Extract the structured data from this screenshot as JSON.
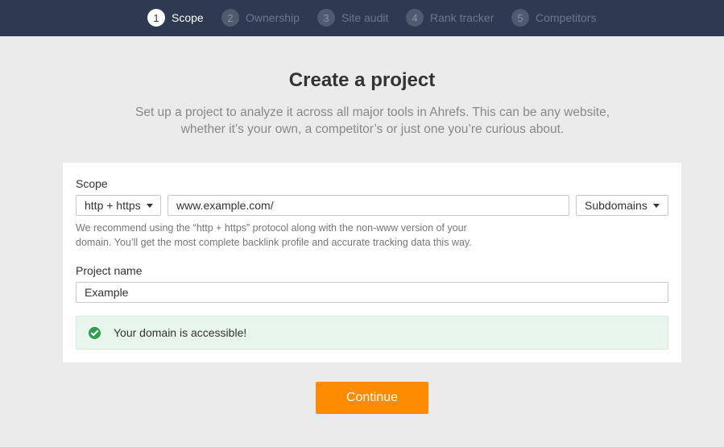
{
  "steps": [
    {
      "num": "1",
      "label": "Scope",
      "active": true
    },
    {
      "num": "2",
      "label": "Ownership",
      "active": false
    },
    {
      "num": "3",
      "label": "Site audit",
      "active": false
    },
    {
      "num": "4",
      "label": "Rank tracker",
      "active": false
    },
    {
      "num": "5",
      "label": "Competitors",
      "active": false
    }
  ],
  "header": {
    "title": "Create a project",
    "subtitle_line1": "Set up a project to analyze it across all major tools in Ahrefs. This can be any website,",
    "subtitle_line2": "whether it’s your own, a competitor’s or just one you’re curious about."
  },
  "scope": {
    "label": "Scope",
    "protocol_selected": "http + https",
    "url_value": "www.example.com/",
    "mode_selected": "Subdomains",
    "hint_line1": "We recommend using the “http + https” protocol along with the non-www version of your",
    "hint_line2": "domain. You’ll get the most complete backlink profile and accurate tracking data this way."
  },
  "project": {
    "label": "Project name",
    "name_value": "Example"
  },
  "status": {
    "message": "Your domain is accessible!",
    "color": "#2e9e4f"
  },
  "actions": {
    "continue_label": "Continue",
    "accent": "#ff8c00"
  },
  "icons": {
    "success": "check-circle-icon",
    "dropdown": "caret-down-icon"
  }
}
